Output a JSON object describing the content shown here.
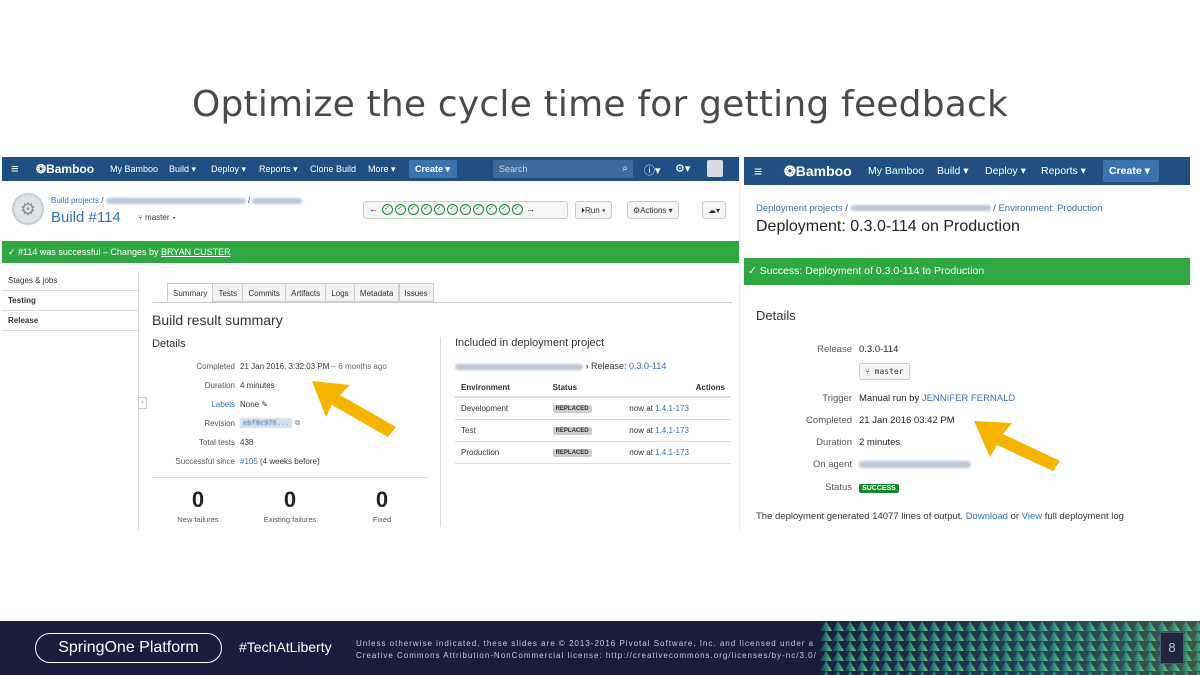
{
  "slide": {
    "title": "Optimize the cycle time for getting feedback",
    "page_number": "8"
  },
  "left": {
    "nav": {
      "logo": "Bamboo",
      "items": [
        "My Bamboo",
        "Build ▾",
        "Deploy ▾",
        "Reports ▾",
        "Clone Build",
        "More ▾"
      ],
      "create": "Create ▾",
      "search_placeholder": "Search"
    },
    "breadcrumb_root": "Build projects",
    "build_title": "Build #114",
    "branch": "master ▾",
    "run_button": "Run ▾",
    "actions_button": "Actions ▾",
    "success_prefix": "#114 was successful – Changes by ",
    "success_user": "BRYAN CUSTER",
    "sidebar": [
      "Stages & jobs",
      "Testing",
      "Release"
    ],
    "tabs": [
      "Summary",
      "Tests",
      "Commits",
      "Artifacts",
      "Logs",
      "Metadata",
      "Issues"
    ],
    "summary_heading": "Build result summary",
    "details_heading": "Details",
    "details": {
      "completed_label": "Completed",
      "completed_value": "21 Jan 2016, 3:32:03 PM",
      "completed_ago": " – 6 months ago",
      "duration_label": "Duration",
      "duration_value": "4 minutes",
      "labels_label": "Labels",
      "labels_value": "None",
      "revision_label": "Revision",
      "revision_value": "ebf8c976...",
      "tests_label": "Total tests",
      "tests_value": "438",
      "since_label": "Successful since",
      "since_link": "#105",
      "since_rest": " (4 weeks before)"
    },
    "counters": [
      {
        "value": "0",
        "label": "New failures"
      },
      {
        "value": "0",
        "label": "Existing failures"
      },
      {
        "value": "0",
        "label": "Fixed"
      }
    ],
    "included_heading": "Included in deployment project",
    "release_prefix": "› Release: ",
    "release_value": "0.3.0-114",
    "env_headers": [
      "Environment",
      "Status",
      "Actions"
    ],
    "envs": [
      {
        "name": "Development",
        "status": "REPLACED",
        "now": "now at ",
        "version": "1.4.1-173"
      },
      {
        "name": "Test",
        "status": "REPLACED",
        "now": "now at ",
        "version": "1.4.1-173"
      },
      {
        "name": "Production",
        "status": "REPLACED",
        "now": "now at ",
        "version": "1.4.1-173"
      }
    ]
  },
  "right": {
    "nav": {
      "logo": "Bamboo",
      "items": [
        "My Bamboo",
        "Build ▾",
        "Deploy ▾",
        "Reports ▾"
      ],
      "create": "Create ▾"
    },
    "breadcrumb_root": "Deployment projects",
    "breadcrumb_env": "Environment: Production",
    "title": "Deployment: 0.3.0-114 on Production",
    "success_text": "Success: Deployment of 0.3.0-114 to Production",
    "details_heading": "Details",
    "release_label": "Release",
    "release_value": "0.3.0-114",
    "branch_chip": "master",
    "trigger_label": "Trigger",
    "trigger_prefix": "Manual run by ",
    "trigger_user": "JENNIFER FERNALD",
    "completed_label": "Completed",
    "completed_value": "21 Jan 2016 03:42 PM",
    "duration_label": "Duration",
    "duration_value": "2 minutes",
    "agent_label": "On agent",
    "status_label": "Status",
    "status_value": "SUCCESS",
    "footer_prefix": "The deployment generated 14077 lines of output. ",
    "footer_download": "Download",
    "footer_or": " or ",
    "footer_view": "View",
    "footer_rest": " full deployment log"
  },
  "band": {
    "brand": "SpringOne Platform",
    "hashtag": "#TechAtLiberty",
    "license_line1": "Unless otherwise indicated, these slides are © 2013-2016 Pivotal Software, Inc. and licensed under a",
    "license_line2": "Creative Commons Attribution-NonCommercial license: http://creativecommons.org/licenses/by-nc/3.0/"
  },
  "colors": {
    "nav": "#205081",
    "success": "#2fa841",
    "link": "#3572b0",
    "arrow": "#f4b400",
    "band": "#1a1c3d"
  }
}
